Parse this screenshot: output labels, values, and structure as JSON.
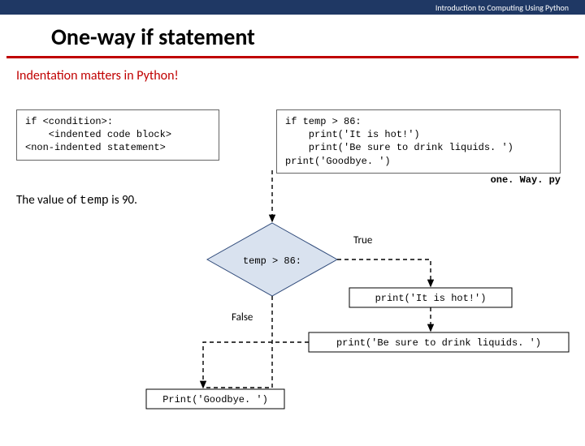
{
  "header": "Introduction to Computing Using Python",
  "title": "One-way if statement",
  "subtitle": "Indentation matters in Python!",
  "codeLeft": "if <condition>:\n    <indented code block>\n<non-indented statement>",
  "codeRight": "if temp > 86:\n    print('It is hot!')\n    print('Be sure to drink liquids. ')\nprint('Goodbye. ')",
  "filename": "one. Way. py",
  "valueLine_pre": "The value of ",
  "valueLine_var": "temp",
  "valueLine_mid": " is ",
  "valueLine_val": "90.",
  "flow": {
    "condition": "temp > 86:",
    "trueLabel": "True",
    "falseLabel": "False",
    "step1": "print('It is hot!')",
    "step2": "print('Be sure to drink liquids. ')",
    "step3": "Print('Goodbye. ')"
  }
}
